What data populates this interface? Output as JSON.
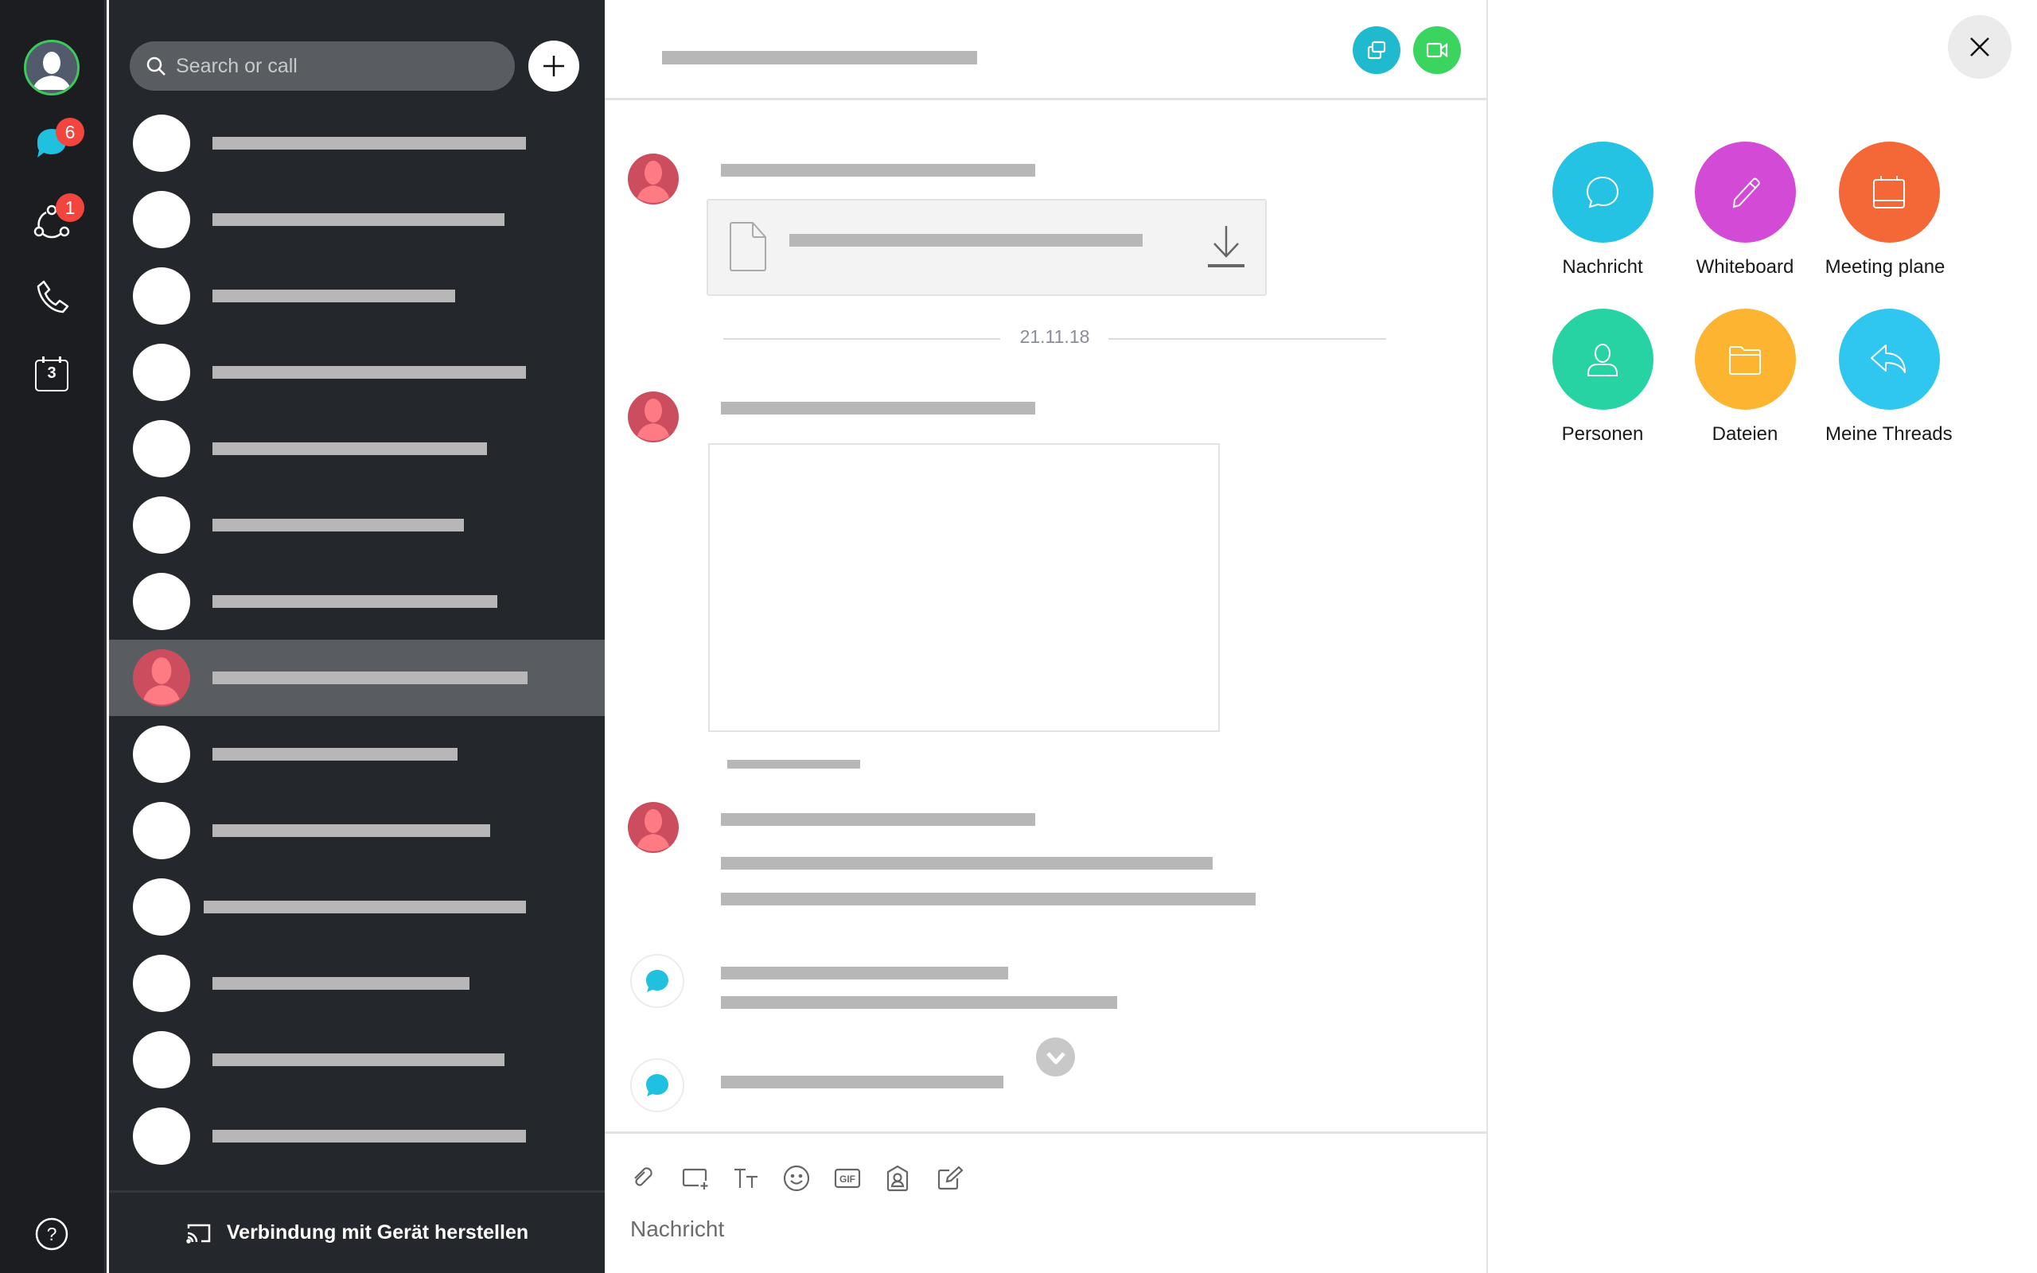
{
  "rail": {
    "items": [
      {
        "name": "profile",
        "icon": "user-avatar-icon"
      },
      {
        "name": "messages",
        "icon": "chat-bubble-icon",
        "badge": "6"
      },
      {
        "name": "meetings",
        "icon": "team-circle-icon",
        "badge": "1"
      },
      {
        "name": "calls",
        "icon": "phone-icon"
      },
      {
        "name": "calendar",
        "icon": "calendar-icon",
        "calendar_day": "3"
      },
      {
        "name": "help",
        "icon": "help-icon"
      }
    ],
    "colors": {
      "bg": "#1b1d21",
      "badge": "#f2453d",
      "chat_accent": "#20c0e0",
      "presence": "#3ec95c"
    }
  },
  "list": {
    "search_placeholder": "Search or call",
    "add_icon": "plus-icon",
    "selected_index": 7,
    "row_count": 14,
    "footer_label": "Verbindung mit Gerät herstellen",
    "footer_icon": "cast-icon",
    "colors": {
      "bg": "#24272b",
      "selected": "#595d61",
      "placeholder_bar": "#b8b7b8"
    }
  },
  "chat": {
    "header_buttons": [
      {
        "name": "share-screen",
        "icon": "share-screen-icon",
        "color": "#1fbacd"
      },
      {
        "name": "video-call",
        "icon": "video-camera-icon",
        "color": "#3ad45f"
      }
    ],
    "date_separator": "21.11.18",
    "composer": {
      "tools": [
        {
          "name": "attach",
          "icon": "paperclip-icon"
        },
        {
          "name": "screenshot",
          "icon": "screen-capture-icon"
        },
        {
          "name": "format",
          "icon": "text-format-icon"
        },
        {
          "name": "emoji",
          "icon": "emoji-icon"
        },
        {
          "name": "gif",
          "icon": "gif-icon"
        },
        {
          "name": "mention",
          "icon": "contact-tag-icon"
        },
        {
          "name": "whiteboard",
          "icon": "compose-icon"
        }
      ],
      "placeholder": "Nachricht"
    }
  },
  "panel": {
    "close_icon": "close-icon",
    "actions": [
      {
        "label": "Nachricht",
        "icon": "message-icon",
        "color": "#24c2e3"
      },
      {
        "label": "Whiteboard",
        "icon": "pencil-icon",
        "color": "#d34ad6"
      },
      {
        "label": "Meeting plane",
        "icon": "calendar-icon",
        "color": "#f46837"
      },
      {
        "label": "Personen",
        "icon": "person-icon",
        "color": "#27d3a3"
      },
      {
        "label": "Dateien",
        "icon": "folder-icon",
        "color": "#fdb431"
      },
      {
        "label": "Meine Threads",
        "icon": "reply-icon",
        "color": "#2fc6f0"
      }
    ]
  }
}
